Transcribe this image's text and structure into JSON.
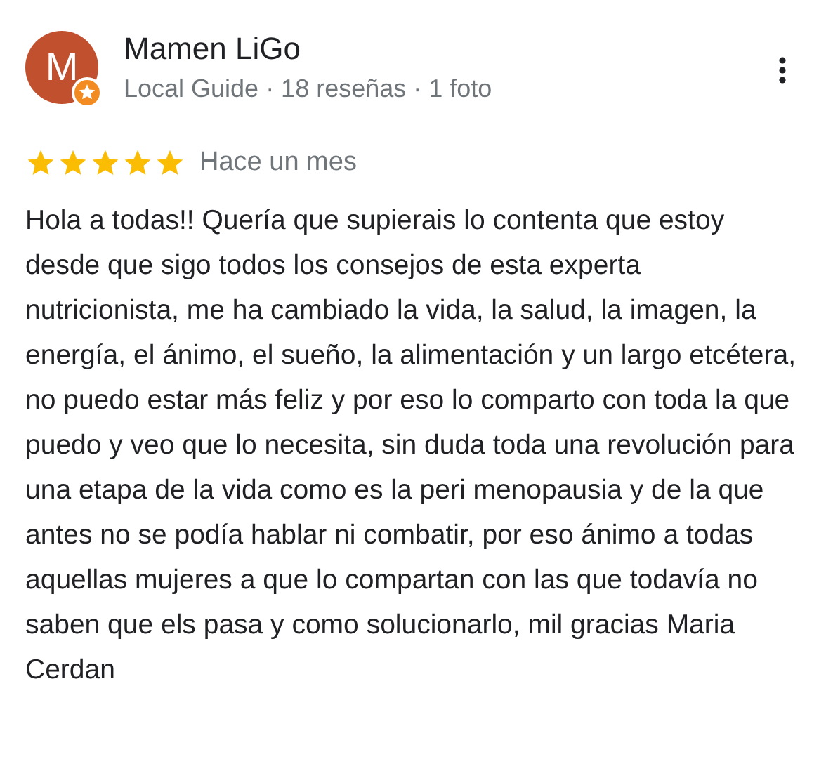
{
  "review": {
    "author": "Mamen LiGo",
    "avatar_letter": "M",
    "local_guide_badge": true,
    "author_info": "Local Guide · 18 reseñas · 1 foto",
    "stars": 5,
    "time": "Hace un mes",
    "text": "Hola a todas!! Quería que supierais lo contenta que estoy desde que sigo todos los consejos de esta experta nutricionista, me ha cambiado la vida, la salud, la imagen, la energía, el ánimo, el sueño, la alimentación y un largo etcétera, no puedo estar más feliz y por eso lo comparto con toda la que puedo y veo que lo necesita, sin duda toda una revolución para una etapa de la vida como es la peri menopausia y de la que antes no se podía hablar ni combatir, por eso ánimo a todas aquellas mujeres a que lo compartan con las que todavía no saben que els pasa y como solucionarlo, mil gracias Maria Cerdan"
  }
}
